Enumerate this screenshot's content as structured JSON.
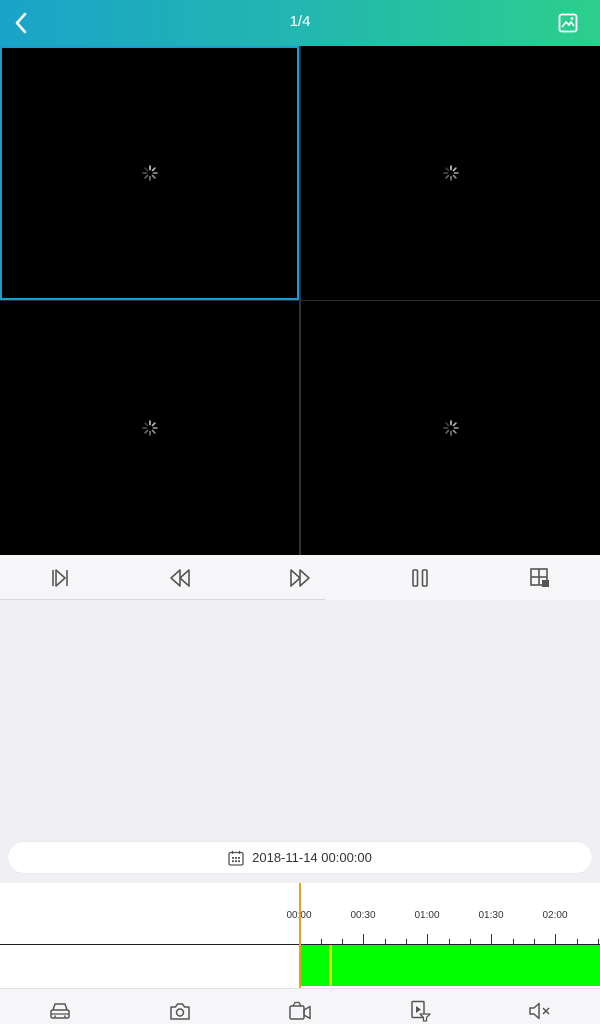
{
  "header": {
    "title": "1/4",
    "back_icon": "chevron-left-icon",
    "right_icon": "image-icon"
  },
  "panes": [
    {
      "state": "loading",
      "active": true
    },
    {
      "state": "loading",
      "active": false
    },
    {
      "state": "loading",
      "active": false
    },
    {
      "state": "loading",
      "active": false
    }
  ],
  "controls": [
    {
      "icon": "skip-to-start-icon"
    },
    {
      "icon": "rewind-icon"
    },
    {
      "icon": "fast-forward-icon"
    },
    {
      "icon": "pause-icon"
    },
    {
      "icon": "layout-grid-icon"
    }
  ],
  "date_picker": {
    "icon": "calendar-icon",
    "value": "2018-11-14 00:00:00"
  },
  "timeline": {
    "labels": [
      "00:00",
      "00:30",
      "01:00",
      "01:30",
      "02:00"
    ],
    "record_color": "#00ff00",
    "position_color": "#e6e200",
    "cursor_color": "#e9a020"
  },
  "bottom_bar": [
    {
      "icon": "car-icon"
    },
    {
      "icon": "camera-icon"
    },
    {
      "icon": "video-record-icon"
    },
    {
      "icon": "playback-filter-icon"
    },
    {
      "icon": "mute-icon"
    }
  ],
  "colors": {
    "header_gradient_start": "#1aa3c8",
    "header_gradient_end": "#2ccf8c",
    "active_pane_border": "#1b9bd0"
  }
}
